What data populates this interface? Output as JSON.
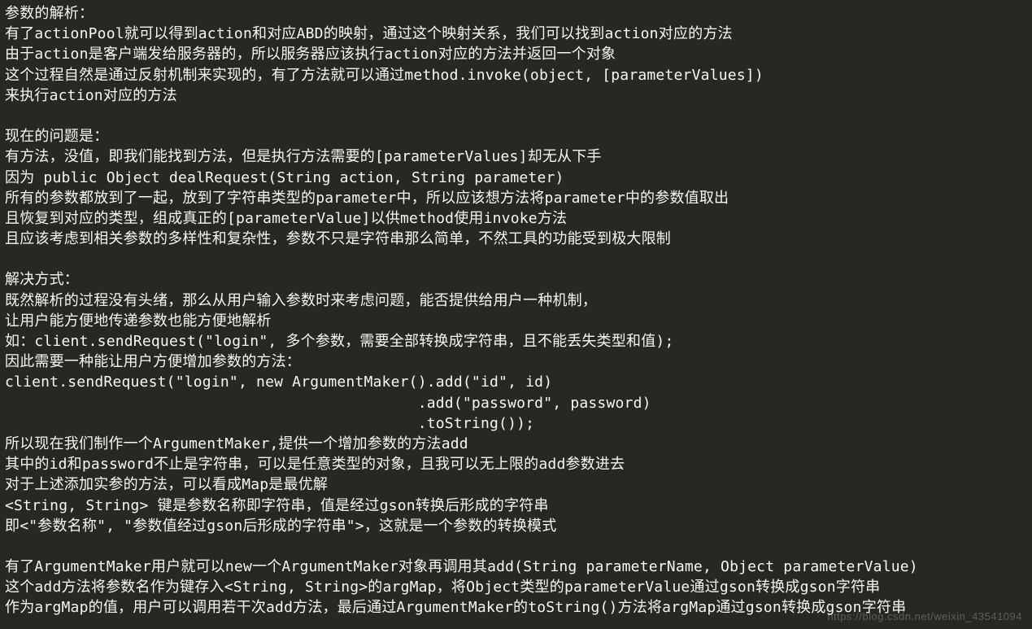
{
  "lines": [
    "参数的解析：",
    "有了actionPool就可以得到action和对应ABD的映射，通过这个映射关系，我们可以找到action对应的方法",
    "由于action是客户端发给服务器的，所以服务器应该执行action对应的方法并返回一个对象",
    "这个过程自然是通过反射机制来实现的，有了方法就可以通过method.invoke(object, [parameterValues])",
    "来执行action对应的方法",
    "",
    "现在的问题是：",
    "有方法，没值，即我们能找到方法，但是执行方法需要的[parameterValues]却无从下手",
    "因为 public Object dealRequest(String action, String parameter)",
    "所有的参数都放到了一起，放到了字符串类型的parameter中，所以应该想方法将parameter中的参数值取出",
    "且恢复到对应的类型，组成真正的[parameterValue]以供method使用invoke方法",
    "且应该考虑到相关参数的多样性和复杂性，参数不只是字符串那么简单，不然工具的功能受到极大限制",
    "",
    "解决方式：",
    "既然解析的过程没有头绪，那么从用户输入参数时来考虑问题，能否提供给用户一种机制，",
    "让用户能方便地传递参数也能方便地解析",
    "如：client.sendRequest(\"login\", 多个参数，需要全部转换成字符串，且不能丢失类型和值);",
    "因此需要一种能让用户方便增加参数的方法：",
    "client.sendRequest(\"login\", new ArgumentMaker().add(\"id\", id)",
    "                                              .add(\"password\", password)",
    "                                              .toString());",
    "所以现在我们制作一个ArgumentMaker,提供一个增加参数的方法add",
    "其中的id和password不止是字符串，可以是任意类型的对象，且我可以无上限的add参数进去",
    "对于上述添加实参的方法，可以看成Map是最优解",
    "<String, String> 键是参数名称即字符串，值是经过gson转换后形成的字符串",
    "即<\"参数名称\", \"参数值经过gson后形成的字符串\">，这就是一个参数的转换模式",
    "",
    "有了ArgumentMaker用户就可以new一个ArgumentMaker对象再调用其add(String parameterName, Object parameterValue)",
    "这个add方法将参数名作为键存入<String, String>的argMap，将Object类型的parameterValue通过gson转换成gson字符串",
    "作为argMap的值，用户可以调用若干次add方法，最后通过ArgumentMaker的toString()方法将argMap通过gson转换成gson字符串"
  ],
  "watermark": "https://blog.csdn.net/weixin_43541094"
}
